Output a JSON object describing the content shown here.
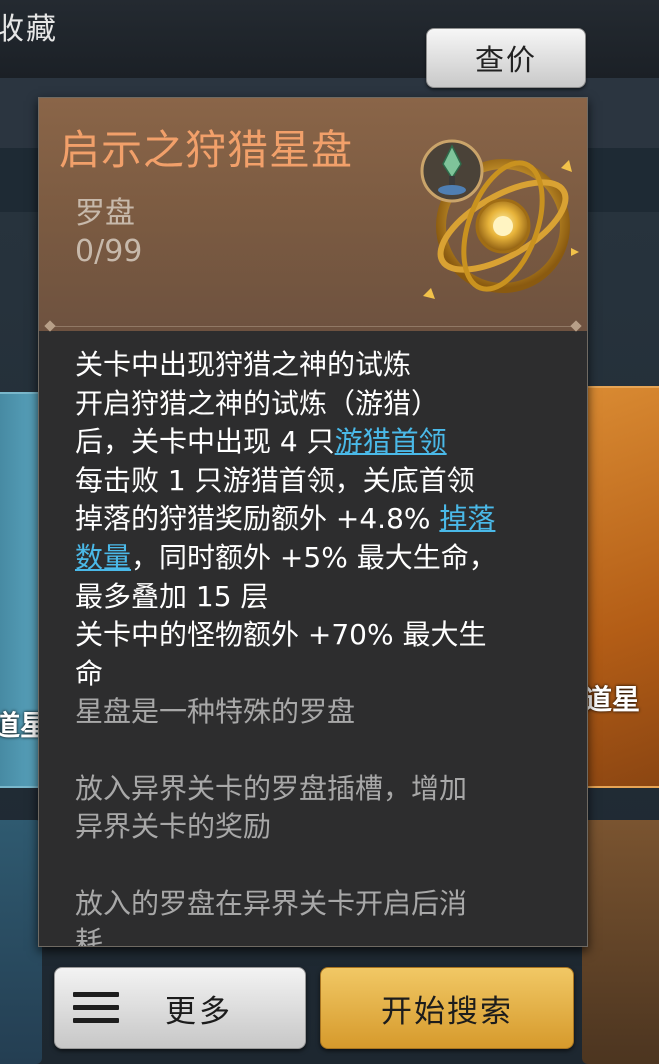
{
  "header": {
    "title": "收藏",
    "price_button": "查价"
  },
  "background_cards": {
    "left_label": "道星",
    "right_label": "道星"
  },
  "item": {
    "name": "启示之狩猎星盘",
    "type": "罗盘",
    "count": "0/99",
    "name_color": "#f2a06a",
    "description": [
      {
        "text": "关卡中出现狩猎之神的试炼"
      },
      {
        "text": "开启狩猎之神的试炼（游猎）"
      },
      {
        "text": "后，关卡中出现 4 只",
        "link": "游猎首领"
      },
      {
        "text": "每击败 1 只游猎首领，关底首领"
      },
      {
        "text": "掉落的狩猎奖励额外 +4.8% ",
        "link": "掉落"
      },
      {
        "link": "数量",
        "after": "，同时额外 +5% 最大生命，"
      },
      {
        "text": "最多叠加 15 层"
      },
      {
        "text": "关卡中的怪物额外 +70% 最大生"
      },
      {
        "text": "命"
      }
    ],
    "lore": [
      "星盘是一种特殊的罗盘",
      "",
      "放入异界关卡的罗盘插槽，增加",
      "异界关卡的奖励",
      "",
      "放入的罗盘在异界关卡开启后消",
      "耗"
    ],
    "link_color": "#4ab9e8"
  },
  "footer": {
    "more_label": "更多",
    "search_label": "开始搜索"
  }
}
